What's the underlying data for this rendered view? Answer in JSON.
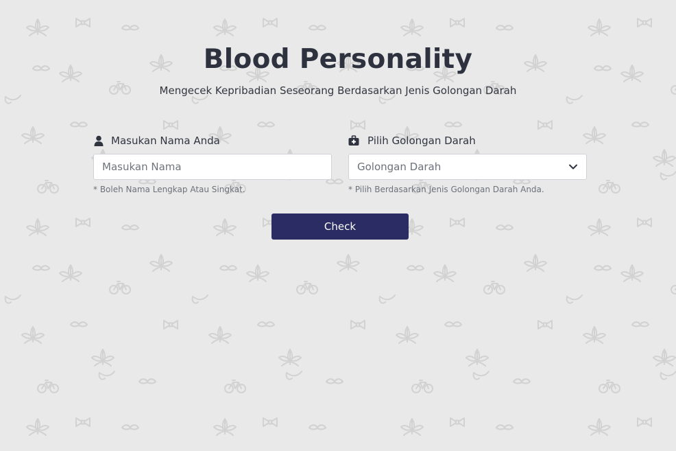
{
  "header": {
    "title": "Blood Personality",
    "subtitle": "Mengecek Kepribadian Seseorang Berdasarkan Jenis Golongan Darah"
  },
  "form": {
    "name": {
      "label": "Masukan Nama Anda",
      "placeholder": "Masukan Nama",
      "value": "",
      "hint": "* Boleh Nama Lengkap Atau Singkat.",
      "icon": "user-icon"
    },
    "blood_type": {
      "label": "Pilih Golongan Darah",
      "selected": "Golongan Darah",
      "hint": "* Pilih Berdasarkan Jenis Golongan Darah Anda.",
      "icon": "medical-kit-icon"
    },
    "submit_label": "Check"
  },
  "colors": {
    "background": "#e9e9e9",
    "pattern": "#d6d6d6",
    "button": "#2c2c64",
    "title": "#2e323f"
  }
}
